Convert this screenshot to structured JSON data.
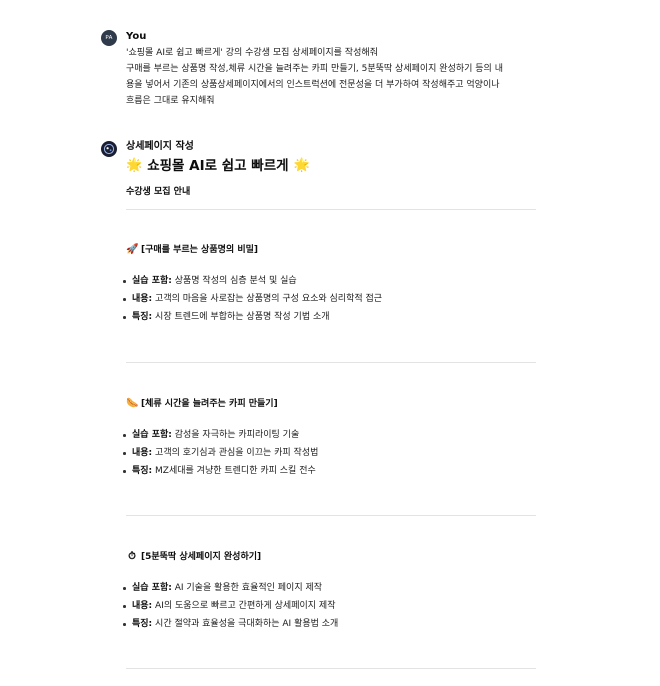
{
  "user_message": {
    "avatar_initials": "PA",
    "sender": "You",
    "lines": [
      "'쇼핑몰 AI로 쉽고 빠르게' 강의 수강생 모집 상세페이지를 작성해줘",
      "구매를 부르는 상품명 작성,체류 시간을 늘려주는 카피 만들기, 5분뚝딱 상세페이지 완성하기 등의 내",
      "용을 넣어서 기존의 상품상세페이지에서의 인스트럭션에 전문성을 더 부가하여 작성해주고 억양이나",
      "흐름은 그대로 유지해줘"
    ]
  },
  "assistant_message": {
    "avatar_icon": "gpt-avatar-icon",
    "sender": "상세페이지 작성",
    "title": "쇼핑몰 AI로 쉽고 빠르게",
    "title_icon": "sparkle-star",
    "subtitle": "수강생 모집 안내",
    "sections": [
      {
        "icon": "🚀",
        "icon_name": "rocket-icon",
        "heading": "[구매를 부르는 상품명의 비밀]",
        "items": [
          {
            "label": "실습 포함:",
            "text": " 상품명 작성의 심층 분석 및 실습"
          },
          {
            "label": "내용:",
            "text": " 고객의 마음을 사로잡는 상품명의 구성 요소와 심리학적 접근"
          },
          {
            "label": "특징:",
            "text": " 시장 트렌드에 부합하는 상품명 작성 기법 소개"
          }
        ]
      },
      {
        "icon": "🌭",
        "icon_name": "hotdog-icon",
        "heading": "[체류 시간을 늘려주는 카피 만들기]",
        "items": [
          {
            "label": "실습 포함:",
            "text": " 감성을 자극하는 카피라이팅 기술"
          },
          {
            "label": "내용:",
            "text": " 고객의 호기심과 관심을 이끄는 카피 작성법"
          },
          {
            "label": "특징:",
            "text": " MZ세대를 겨냥한 트렌디한 카피 스킬 전수"
          }
        ]
      },
      {
        "icon": "⏱",
        "icon_name": "stopwatch-icon",
        "heading": "[5분뚝딱 상세페이지 완성하기]",
        "items": [
          {
            "label": "실습 포함:",
            "text": " AI 기술을 활용한 효율적인 페이지 제작"
          },
          {
            "label": "내용:",
            "text": " AI의 도움으로 빠르고 간편하게 상세페이지 제작"
          },
          {
            "label": "특징:",
            "text": " 시간 절약과 효율성을 극대화하는 AI 활용법 소개"
          }
        ]
      }
    ]
  }
}
